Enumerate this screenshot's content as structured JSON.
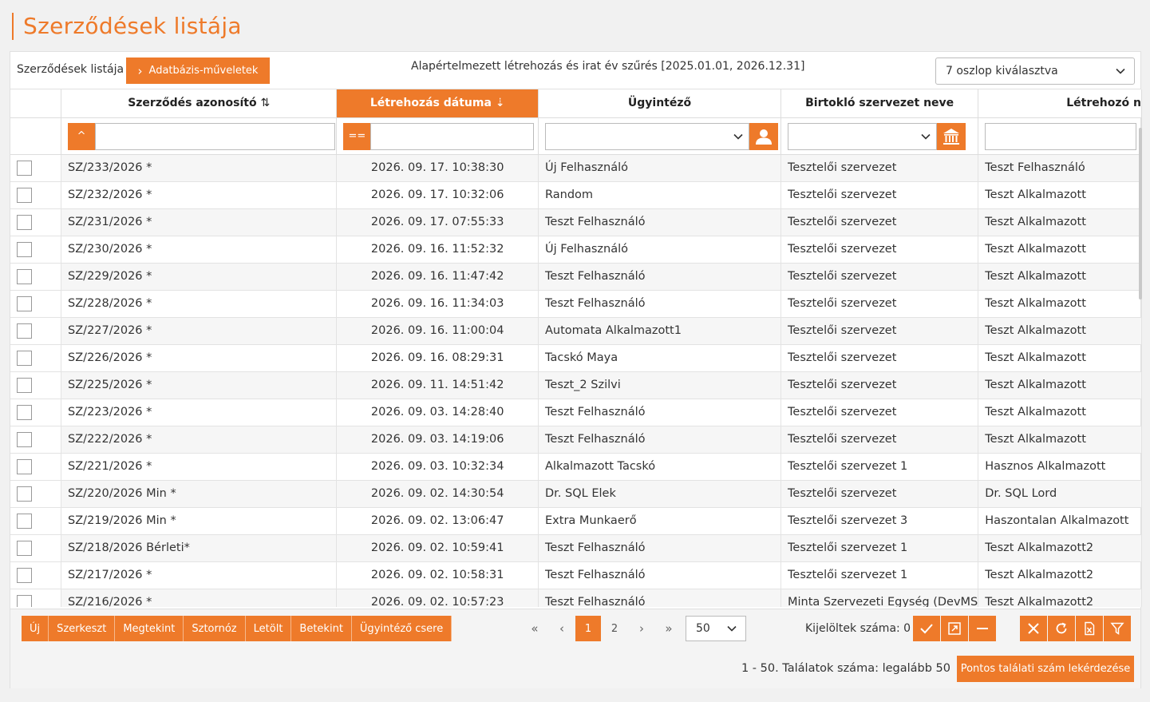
{
  "page": {
    "title": "Szerződések listája"
  },
  "toolbar": {
    "list_label": "Szerződések listája",
    "db_button": "Adatbázis-műveletek",
    "filter_info": "Alapértelmezett létrehozás és irat év szűrés [2025.01.01, 2026.12.31]",
    "column_selector": "7 oszlop kiválasztva"
  },
  "columns": [
    {
      "label": "Szerződés azonosító",
      "sort_icon": "sort-both-icon",
      "active": false
    },
    {
      "label": "Létrehozás dátuma",
      "sort_icon": "sort-desc-icon",
      "active": true
    },
    {
      "label": "Ügyintéző",
      "active": false
    },
    {
      "label": "Birtokló szervezet neve",
      "active": false
    },
    {
      "label": "Létrehozó n",
      "active": false
    }
  ],
  "filters": {
    "id_operator": "^",
    "date_operator": "=="
  },
  "rows": [
    [
      "SZ/233/2026 *",
      "2026. 09. 17. 10:38:30",
      "Új Felhasználó",
      "Tesztelői szervezet",
      "Teszt Felhasználó"
    ],
    [
      "SZ/232/2026 *",
      "2026. 09. 17. 10:32:06",
      "Random",
      "Tesztelői szervezet",
      "Teszt Alkalmazott"
    ],
    [
      "SZ/231/2026 *",
      "2026. 09. 17. 07:55:33",
      "Teszt Felhasználó",
      "Tesztelői szervezet",
      "Teszt Alkalmazott"
    ],
    [
      "SZ/230/2026 *",
      "2026. 09. 16. 11:52:32",
      "Új Felhasználó",
      "Tesztelői szervezet",
      "Teszt Alkalmazott"
    ],
    [
      "SZ/229/2026 *",
      "2026. 09. 16. 11:47:42",
      "Teszt Felhasználó",
      "Tesztelői szervezet",
      "Teszt Alkalmazott"
    ],
    [
      "SZ/228/2026 *",
      "2026. 09. 16. 11:34:03",
      "Teszt Felhasználó",
      "Tesztelői szervezet",
      "Teszt Alkalmazott"
    ],
    [
      "SZ/227/2026 *",
      "2026. 09. 16. 11:00:04",
      "Automata Alkalmazott1",
      "Tesztelői szervezet",
      "Teszt Alkalmazott"
    ],
    [
      "SZ/226/2026 *",
      "2026. 09. 16. 08:29:31",
      "Tacskó Maya",
      "Tesztelői szervezet",
      "Teszt Alkalmazott"
    ],
    [
      "SZ/225/2026 *",
      "2026. 09. 11. 14:51:42",
      "Teszt_2 Szilvi",
      "Tesztelői szervezet",
      "Teszt Alkalmazott"
    ],
    [
      "SZ/223/2026 *",
      "2026. 09. 03. 14:28:40",
      "Teszt Felhasználó",
      "Tesztelői szervezet",
      "Teszt Alkalmazott"
    ],
    [
      "SZ/222/2026 *",
      "2026. 09. 03. 14:19:06",
      "Teszt Felhasználó",
      "Tesztelői szervezet",
      "Teszt Alkalmazott"
    ],
    [
      "SZ/221/2026 *",
      "2026. 09. 03. 10:32:34",
      "Alkalmazott Tacskó",
      "Tesztelői szervezet 1",
      "Hasznos Alkalmazott"
    ],
    [
      "SZ/220/2026 Min *",
      "2026. 09. 02. 14:30:54",
      "Dr. SQL Elek",
      "Tesztelői szervezet",
      "Dr. SQL Lord"
    ],
    [
      "SZ/219/2026 Min *",
      "2026. 09. 02. 13:06:47",
      "Extra Munkaerő",
      "Tesztelői szervezet 3",
      "Haszontalan Alkalmazott"
    ],
    [
      "SZ/218/2026 Bérleti*",
      "2026. 09. 02. 10:59:41",
      "Teszt Felhasználó",
      "Tesztelői szervezet 1",
      "Teszt Alkalmazott2"
    ],
    [
      "SZ/217/2026 *",
      "2026. 09. 02. 10:58:31",
      "Teszt Felhasználó",
      "Tesztelői szervezet 1",
      "Teszt Alkalmazott2"
    ],
    [
      "SZ/216/2026 *",
      "2026. 09. 02. 10:57:23",
      "Teszt Felhasználó",
      "Minta Szervezeti Egység (DevMS",
      "Teszt Alkalmazott2"
    ]
  ],
  "actions": [
    "Új",
    "Szerkeszt",
    "Megtekint",
    "Sztornóz",
    "Letölt",
    "Betekint",
    "Ügyintéző csere"
  ],
  "pager": {
    "first": "«",
    "prev": "‹",
    "pages": [
      "1",
      "2"
    ],
    "current": "1",
    "next": "›",
    "last": "»",
    "page_size": "50"
  },
  "selection": {
    "label": "Kijelöltek száma: 0"
  },
  "footer": {
    "total_text": "1 - 50. Találatok száma: legalább 50",
    "exact_button": "Pontos találati szám lekérdezése"
  },
  "colors": {
    "accent": "#ee7a2a"
  }
}
